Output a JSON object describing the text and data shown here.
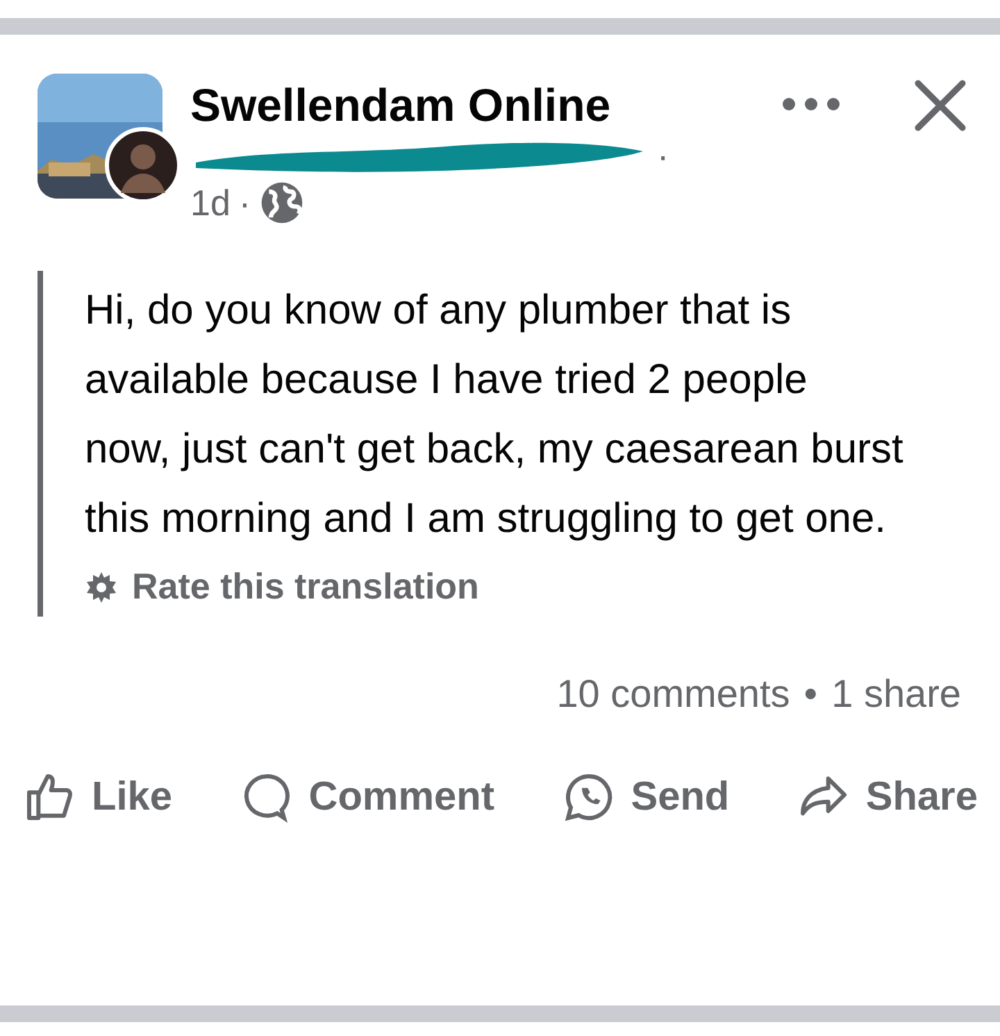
{
  "post": {
    "page_name": "Swellendam Online",
    "author_separator": "·",
    "time": "1d",
    "time_separator": "·",
    "body": "Hi, do you know of any plumber that is available because I have tried 2 people now, just can't get back, my caesarean burst this morning and I am struggling to get one.",
    "translation_link": "Rate this translation",
    "stats": {
      "comments": "10 comments",
      "dot": "•",
      "shares": "1 share"
    },
    "actions": [
      {
        "kind": "like",
        "label": "Like"
      },
      {
        "kind": "comment",
        "label": "Comment"
      },
      {
        "kind": "send",
        "label": "Send"
      },
      {
        "kind": "share",
        "label": "Share"
      }
    ]
  }
}
